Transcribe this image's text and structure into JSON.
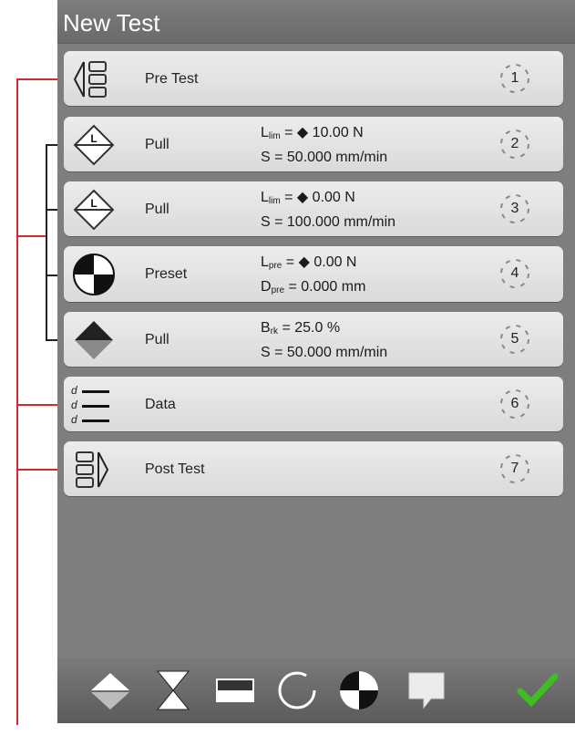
{
  "window": {
    "title": "New Test"
  },
  "steps": [
    {
      "name": "Pre Test",
      "number": "1"
    },
    {
      "name": "Pull",
      "number": "2",
      "l1_pre": "L",
      "l1_sub": "lim",
      "l1_rest": " = ◆ 10.00 N",
      "l2": "S = 50.000 mm/min"
    },
    {
      "name": "Pull",
      "number": "3",
      "l1_pre": "L",
      "l1_sub": "lim",
      "l1_rest": " = ◆ 0.00 N",
      "l2": "S = 100.000 mm/min"
    },
    {
      "name": "Preset",
      "number": "4",
      "l1_pre": "L",
      "l1_sub": "pre",
      "l1_rest": " = ◆ 0.00 N",
      "l2_pre": "D",
      "l2_sub": "pre",
      "l2_rest": " = 0.000 mm"
    },
    {
      "name": "Pull",
      "number": "5",
      "l1_pre": "B",
      "l1_sub": "rk",
      "l1_rest": " = 25.0 %",
      "l2": "S = 50.000 mm/min"
    },
    {
      "name": "Data",
      "number": "6"
    },
    {
      "name": "Post Test",
      "number": "7"
    }
  ],
  "icons": {
    "data_letter": "d",
    "toolbar": [
      "pull-step-icon",
      "hold-step-icon",
      "stop-step-icon",
      "cycle-step-icon",
      "preset-step-icon",
      "comment-step-icon",
      "confirm-check-icon"
    ]
  },
  "colors": {
    "callout": "#d12b2b",
    "check": "#3fbf1f"
  }
}
